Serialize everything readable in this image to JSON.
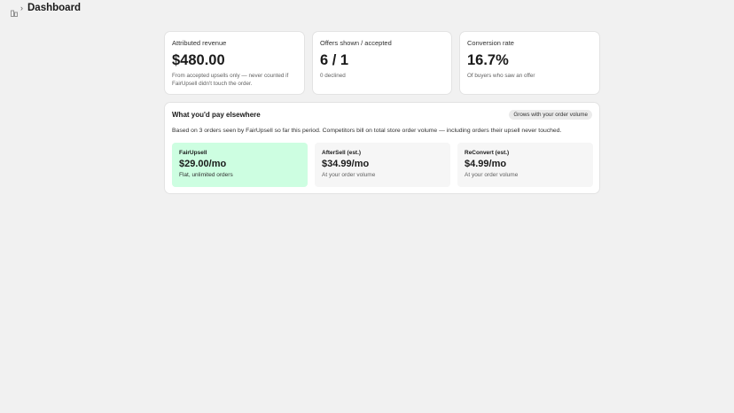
{
  "header": {
    "app_icon": "store-icon",
    "title": "Dashboard"
  },
  "stats": [
    {
      "title": "Attributed revenue",
      "value": "$480.00",
      "sub": "From accepted upsells only — never counted if FairUpsell didn't touch the order."
    },
    {
      "title": "Offers shown / accepted",
      "value": "6 / 1",
      "sub": "0 declined"
    },
    {
      "title": "Conversion rate",
      "value": "16.7%",
      "sub": "Of buyers who saw an offer"
    }
  ],
  "comparison": {
    "title": "What you'd pay elsewhere",
    "badge": "Grows with your order volume",
    "description": "Based on 3 orders seen by FairUpsell so far this period. Competitors bill on total store order volume — including orders their upsell never touched.",
    "plans": [
      {
        "name": "FairUpsell",
        "price": "$29.00/mo",
        "note": "Flat, unlimited orders"
      },
      {
        "name": "AfterSell (est.)",
        "price": "$34.99/mo",
        "note": "At your order volume"
      },
      {
        "name": "ReConvert (est.)",
        "price": "$4.99/mo",
        "note": "At your order volume"
      }
    ]
  },
  "colors": {
    "highlight": "#cdfee1",
    "background": "#f1f1f1"
  }
}
